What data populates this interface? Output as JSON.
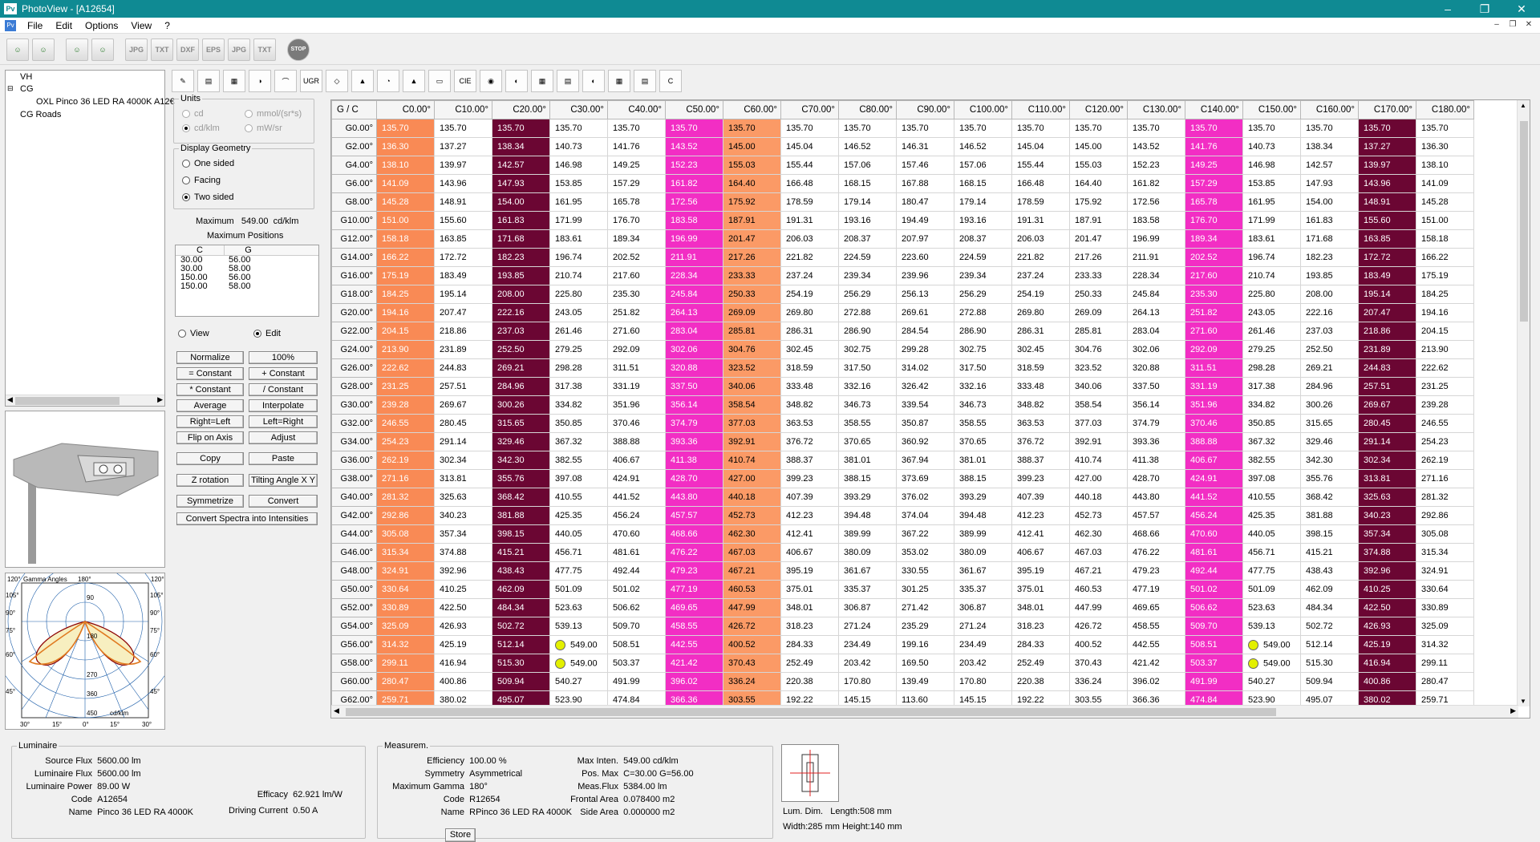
{
  "window": {
    "title": "PhotoView - [A12654]",
    "icon": "Pv",
    "doc_icon": "Pv"
  },
  "menu": [
    "File",
    "Edit",
    "Options",
    "View",
    "?"
  ],
  "toolbar1": [
    {
      "icon": "multi-person-icon",
      "label": ""
    },
    {
      "icon": "multi-person-icon",
      "label": ""
    },
    {
      "icon": "multi-person-icon",
      "label": ""
    },
    {
      "icon": "multi-person-icon",
      "label": ""
    },
    {
      "icon": "export-jpg-icon",
      "label": "JPG"
    },
    {
      "icon": "export-txt-icon",
      "label": "TXT"
    },
    {
      "icon": "export-dxf-icon",
      "label": "DXF"
    },
    {
      "icon": "export-eps-icon",
      "label": "EPS"
    },
    {
      "icon": "export-jpg-icon",
      "label": "JPG"
    },
    {
      "icon": "export-txt-icon",
      "label": "TXT"
    },
    {
      "icon": "stop-icon",
      "label": "STOP"
    }
  ],
  "tree": {
    "items": [
      "VH",
      "CG",
      "OXL Pinco 36 LED RA 4000K A12€",
      "CG Roads"
    ]
  },
  "units": {
    "title": "Units",
    "opts": [
      "cd",
      "cd/klm",
      "mmol/(sr*s)",
      "mW/sr"
    ],
    "selected": 1
  },
  "display_geometry": {
    "title": "Display Geometry",
    "opts": [
      "One sided",
      "Facing",
      "Two sided"
    ],
    "selected": 2
  },
  "maximum": {
    "label": "Maximum",
    "value": "549.00",
    "unit": "cd/klm"
  },
  "max_positions": {
    "title": "Maximum Positions",
    "headers": [
      "C",
      "G"
    ],
    "rows": [
      [
        "30.00",
        "56.00"
      ],
      [
        "30.00",
        "58.00"
      ],
      [
        "150.00",
        "56.00"
      ],
      [
        "150.00",
        "58.00"
      ]
    ]
  },
  "mode": {
    "opts": [
      "View",
      "Edit"
    ],
    "selected": 1
  },
  "buttons": [
    "Normalize",
    "100%",
    "= Constant",
    "+ Constant",
    "* Constant",
    "/ Constant",
    "Average",
    "Interpolate",
    "Right=Left",
    "Left=Right",
    "Flip on Axis",
    "Adjust",
    "Copy",
    "Paste",
    "Z rotation",
    "Tilting Angle X Y",
    "Symmetrize",
    "Convert",
    "Convert Spectra into Intensities"
  ],
  "polar": {
    "left_top": "120°",
    "title": "Gamma Angles",
    "title_val": "180°",
    "right_top": "120°",
    "left_labels": [
      "105°",
      "90°",
      "75°",
      "60°",
      "45°"
    ],
    "right_labels": [
      "105°",
      "90°",
      "75°",
      "60°",
      "45°"
    ],
    "radial": [
      "90",
      "180",
      "270",
      "360",
      "450"
    ],
    "unit": "cd/klm",
    "bottom": [
      "30°",
      "15°",
      "0°",
      "15°",
      "30°"
    ]
  },
  "toolbar2": [
    "edit-icon",
    "chart-icon",
    "table-icon",
    "polar-icon",
    "curve-icon",
    "ugr-icon",
    "iso-icon",
    "fan-icon",
    "arc-icon",
    "cone-icon",
    "area-icon",
    "cie-icon",
    "sphere-icon",
    "dome-icon",
    "grid-icon",
    "bars-icon",
    "bulb-icon",
    "tiles-icon",
    "report-icon",
    "c-icon"
  ],
  "grid": {
    "corner": "G / C",
    "columns": [
      "C0.00°",
      "C10.00°",
      "C20.00°",
      "C30.00°",
      "C40.00°",
      "C50.00°",
      "C60.00°",
      "C70.00°",
      "C80.00°",
      "C90.00°",
      "C100.00°",
      "C110.00°",
      "C120.00°",
      "C130.00°",
      "C140.00°",
      "C150.00°",
      "C160.00°",
      "C170.00°",
      "C180.00°"
    ],
    "col_color": [
      "or",
      "",
      "pu",
      "",
      "",
      "pi",
      "sa",
      "",
      "",
      "",
      "",
      "",
      "",
      "",
      "pi",
      "",
      "",
      "pu",
      ""
    ],
    "rows": [
      [
        "G0.00°",
        "135.70",
        "135.70",
        "135.70",
        "135.70",
        "135.70",
        "135.70",
        "135.70",
        "135.70",
        "135.70",
        "135.70",
        "135.70",
        "135.70",
        "135.70",
        "135.70",
        "135.70",
        "135.70",
        "135.70",
        "135.70",
        "135.70"
      ],
      [
        "G2.00°",
        "136.30",
        "137.27",
        "138.34",
        "140.73",
        "141.76",
        "143.52",
        "145.00",
        "145.04",
        "146.52",
        "146.31",
        "146.52",
        "145.04",
        "145.00",
        "143.52",
        "141.76",
        "140.73",
        "138.34",
        "137.27",
        "136.30"
      ],
      [
        "G4.00°",
        "138.10",
        "139.97",
        "142.57",
        "146.98",
        "149.25",
        "152.23",
        "155.03",
        "155.44",
        "157.06",
        "157.46",
        "157.06",
        "155.44",
        "155.03",
        "152.23",
        "149.25",
        "146.98",
        "142.57",
        "139.97",
        "138.10"
      ],
      [
        "G6.00°",
        "141.09",
        "143.96",
        "147.93",
        "153.85",
        "157.29",
        "161.82",
        "164.40",
        "166.48",
        "168.15",
        "167.88",
        "168.15",
        "166.48",
        "164.40",
        "161.82",
        "157.29",
        "153.85",
        "147.93",
        "143.96",
        "141.09"
      ],
      [
        "G8.00°",
        "145.28",
        "148.91",
        "154.00",
        "161.95",
        "165.78",
        "172.56",
        "175.92",
        "178.59",
        "179.14",
        "180.47",
        "179.14",
        "178.59",
        "175.92",
        "172.56",
        "165.78",
        "161.95",
        "154.00",
        "148.91",
        "145.28"
      ],
      [
        "G10.00°",
        "151.00",
        "155.60",
        "161.83",
        "171.99",
        "176.70",
        "183.58",
        "187.91",
        "191.31",
        "193.16",
        "194.49",
        "193.16",
        "191.31",
        "187.91",
        "183.58",
        "176.70",
        "171.99",
        "161.83",
        "155.60",
        "151.00"
      ],
      [
        "G12.00°",
        "158.18",
        "163.85",
        "171.68",
        "183.61",
        "189.34",
        "196.99",
        "201.47",
        "206.03",
        "208.37",
        "207.97",
        "208.37",
        "206.03",
        "201.47",
        "196.99",
        "189.34",
        "183.61",
        "171.68",
        "163.85",
        "158.18"
      ],
      [
        "G14.00°",
        "166.22",
        "172.72",
        "182.23",
        "196.74",
        "202.52",
        "211.91",
        "217.26",
        "221.82",
        "224.59",
        "223.60",
        "224.59",
        "221.82",
        "217.26",
        "211.91",
        "202.52",
        "196.74",
        "182.23",
        "172.72",
        "166.22"
      ],
      [
        "G16.00°",
        "175.19",
        "183.49",
        "193.85",
        "210.74",
        "217.60",
        "228.34",
        "233.33",
        "237.24",
        "239.34",
        "239.96",
        "239.34",
        "237.24",
        "233.33",
        "228.34",
        "217.60",
        "210.74",
        "193.85",
        "183.49",
        "175.19"
      ],
      [
        "G18.00°",
        "184.25",
        "195.14",
        "208.00",
        "225.80",
        "235.30",
        "245.84",
        "250.33",
        "254.19",
        "256.29",
        "256.13",
        "256.29",
        "254.19",
        "250.33",
        "245.84",
        "235.30",
        "225.80",
        "208.00",
        "195.14",
        "184.25"
      ],
      [
        "G20.00°",
        "194.16",
        "207.47",
        "222.16",
        "243.05",
        "251.82",
        "264.13",
        "269.09",
        "269.80",
        "272.88",
        "269.61",
        "272.88",
        "269.80",
        "269.09",
        "264.13",
        "251.82",
        "243.05",
        "222.16",
        "207.47",
        "194.16"
      ],
      [
        "G22.00°",
        "204.15",
        "218.86",
        "237.03",
        "261.46",
        "271.60",
        "283.04",
        "285.81",
        "286.31",
        "286.90",
        "284.54",
        "286.90",
        "286.31",
        "285.81",
        "283.04",
        "271.60",
        "261.46",
        "237.03",
        "218.86",
        "204.15"
      ],
      [
        "G24.00°",
        "213.90",
        "231.89",
        "252.50",
        "279.25",
        "292.09",
        "302.06",
        "304.76",
        "302.45",
        "302.75",
        "299.28",
        "302.75",
        "302.45",
        "304.76",
        "302.06",
        "292.09",
        "279.25",
        "252.50",
        "231.89",
        "213.90"
      ],
      [
        "G26.00°",
        "222.62",
        "244.83",
        "269.21",
        "298.28",
        "311.51",
        "320.88",
        "323.52",
        "318.59",
        "317.50",
        "314.02",
        "317.50",
        "318.59",
        "323.52",
        "320.88",
        "311.51",
        "298.28",
        "269.21",
        "244.83",
        "222.62"
      ],
      [
        "G28.00°",
        "231.25",
        "257.51",
        "284.96",
        "317.38",
        "331.19",
        "337.50",
        "340.06",
        "333.48",
        "332.16",
        "326.42",
        "332.16",
        "333.48",
        "340.06",
        "337.50",
        "331.19",
        "317.38",
        "284.96",
        "257.51",
        "231.25"
      ],
      [
        "G30.00°",
        "239.28",
        "269.67",
        "300.26",
        "334.82",
        "351.96",
        "356.14",
        "358.54",
        "348.82",
        "346.73",
        "339.54",
        "346.73",
        "348.82",
        "358.54",
        "356.14",
        "351.96",
        "334.82",
        "300.26",
        "269.67",
        "239.28"
      ],
      [
        "G32.00°",
        "246.55",
        "280.45",
        "315.65",
        "350.85",
        "370.46",
        "374.79",
        "377.03",
        "363.53",
        "358.55",
        "350.87",
        "358.55",
        "363.53",
        "377.03",
        "374.79",
        "370.46",
        "350.85",
        "315.65",
        "280.45",
        "246.55"
      ],
      [
        "G34.00°",
        "254.23",
        "291.14",
        "329.46",
        "367.32",
        "388.88",
        "393.36",
        "392.91",
        "376.72",
        "370.65",
        "360.92",
        "370.65",
        "376.72",
        "392.91",
        "393.36",
        "388.88",
        "367.32",
        "329.46",
        "291.14",
        "254.23"
      ],
      [
        "G36.00°",
        "262.19",
        "302.34",
        "342.30",
        "382.55",
        "406.67",
        "411.38",
        "410.74",
        "388.37",
        "381.01",
        "367.94",
        "381.01",
        "388.37",
        "410.74",
        "411.38",
        "406.67",
        "382.55",
        "342.30",
        "302.34",
        "262.19"
      ],
      [
        "G38.00°",
        "271.16",
        "313.81",
        "355.76",
        "397.08",
        "424.91",
        "428.70",
        "427.00",
        "399.23",
        "388.15",
        "373.69",
        "388.15",
        "399.23",
        "427.00",
        "428.70",
        "424.91",
        "397.08",
        "355.76",
        "313.81",
        "271.16"
      ],
      [
        "G40.00°",
        "281.32",
        "325.63",
        "368.42",
        "410.55",
        "441.52",
        "443.80",
        "440.18",
        "407.39",
        "393.29",
        "376.02",
        "393.29",
        "407.39",
        "440.18",
        "443.80",
        "441.52",
        "410.55",
        "368.42",
        "325.63",
        "281.32"
      ],
      [
        "G42.00°",
        "292.86",
        "340.23",
        "381.88",
        "425.35",
        "456.24",
        "457.57",
        "452.73",
        "412.23",
        "394.48",
        "374.04",
        "394.48",
        "412.23",
        "452.73",
        "457.57",
        "456.24",
        "425.35",
        "381.88",
        "340.23",
        "292.86"
      ],
      [
        "G44.00°",
        "305.08",
        "357.34",
        "398.15",
        "440.05",
        "470.60",
        "468.66",
        "462.30",
        "412.41",
        "389.99",
        "367.22",
        "389.99",
        "412.41",
        "462.30",
        "468.66",
        "470.60",
        "440.05",
        "398.15",
        "357.34",
        "305.08"
      ],
      [
        "G46.00°",
        "315.34",
        "374.88",
        "415.21",
        "456.71",
        "481.61",
        "476.22",
        "467.03",
        "406.67",
        "380.09",
        "353.02",
        "380.09",
        "406.67",
        "467.03",
        "476.22",
        "481.61",
        "456.71",
        "415.21",
        "374.88",
        "315.34"
      ],
      [
        "G48.00°",
        "324.91",
        "392.96",
        "438.43",
        "477.75",
        "492.44",
        "479.23",
        "467.21",
        "395.19",
        "361.67",
        "330.55",
        "361.67",
        "395.19",
        "467.21",
        "479.23",
        "492.44",
        "477.75",
        "438.43",
        "392.96",
        "324.91"
      ],
      [
        "G50.00°",
        "330.64",
        "410.25",
        "462.09",
        "501.09",
        "501.02",
        "477.19",
        "460.53",
        "375.01",
        "335.37",
        "301.25",
        "335.37",
        "375.01",
        "460.53",
        "477.19",
        "501.02",
        "501.09",
        "462.09",
        "410.25",
        "330.64"
      ],
      [
        "G52.00°",
        "330.89",
        "422.50",
        "484.34",
        "523.63",
        "506.62",
        "469.65",
        "447.99",
        "348.01",
        "306.87",
        "271.42",
        "306.87",
        "348.01",
        "447.99",
        "469.65",
        "506.62",
        "523.63",
        "484.34",
        "422.50",
        "330.89"
      ],
      [
        "G54.00°",
        "325.09",
        "426.93",
        "502.72",
        "539.13",
        "509.70",
        "458.55",
        "426.72",
        "318.23",
        "271.24",
        "235.29",
        "271.24",
        "318.23",
        "426.72",
        "458.55",
        "509.70",
        "539.13",
        "502.72",
        "426.93",
        "325.09"
      ],
      [
        "G56.00°",
        "314.32",
        "425.19",
        "512.14",
        "549.00",
        "508.51",
        "442.55",
        "400.52",
        "284.33",
        "234.49",
        "199.16",
        "234.49",
        "284.33",
        "400.52",
        "442.55",
        "508.51",
        "549.00",
        "512.14",
        "425.19",
        "314.32"
      ],
      [
        "G58.00°",
        "299.11",
        "416.94",
        "515.30",
        "549.00",
        "503.37",
        "421.42",
        "370.43",
        "252.49",
        "203.42",
        "169.50",
        "203.42",
        "252.49",
        "370.43",
        "421.42",
        "503.37",
        "549.00",
        "515.30",
        "416.94",
        "299.11"
      ],
      [
        "G60.00°",
        "280.47",
        "400.86",
        "509.94",
        "540.27",
        "491.99",
        "396.02",
        "336.24",
        "220.38",
        "170.80",
        "139.49",
        "170.80",
        "220.38",
        "336.24",
        "396.02",
        "491.99",
        "540.27",
        "509.94",
        "400.86",
        "280.47"
      ],
      [
        "G62.00°",
        "259.71",
        "380.02",
        "495.07",
        "523.90",
        "474.84",
        "366.36",
        "303.55",
        "192.22",
        "145.15",
        "113.60",
        "145.15",
        "192.22",
        "303.55",
        "366.36",
        "474.84",
        "523.90",
        "495.07",
        "380.02",
        "259.71"
      ]
    ],
    "max_cells": [
      [
        28,
        4
      ],
      [
        29,
        4
      ],
      [
        28,
        16
      ],
      [
        29,
        16
      ]
    ]
  },
  "luminaire": {
    "title": "Luminaire",
    "rows": [
      [
        "Source Flux",
        "5600.00 lm"
      ],
      [
        "Luminaire Flux",
        "5600.00 lm"
      ],
      [
        "Luminaire Power",
        "89.00 W"
      ],
      [
        "Code",
        "A12654"
      ],
      [
        "Name",
        "Pinco 36 LED RA 4000K"
      ]
    ],
    "efficacy": [
      "Efficacy",
      "62.921 lm/W"
    ],
    "current": [
      "Driving Current",
      "0.50 A"
    ]
  },
  "measurement": {
    "title": "Measurem.",
    "rows": [
      [
        "Efficiency",
        "100.00 %"
      ],
      [
        "Symmetry",
        "Asymmetrical"
      ],
      [
        "Maximum Gamma",
        "180°"
      ],
      [
        "Code",
        "R12654"
      ],
      [
        "Name",
        "RPinco 36 LED RA 4000K"
      ]
    ],
    "right": [
      [
        "Max Inten.",
        "549.00  cd/klm"
      ],
      [
        "Pos. Max",
        "C=30.00 G=56.00"
      ],
      [
        "Meas.Flux",
        "5384.00 lm"
      ],
      [
        "Frontal Area",
        "0.078400 m2"
      ],
      [
        "Side Area",
        "0.000000 m2"
      ]
    ],
    "store": "Store"
  },
  "dims": {
    "label": "Lum. Dim.",
    "length": "Length:508 mm",
    "wh": "Width:285 mm Height:140 mm"
  }
}
